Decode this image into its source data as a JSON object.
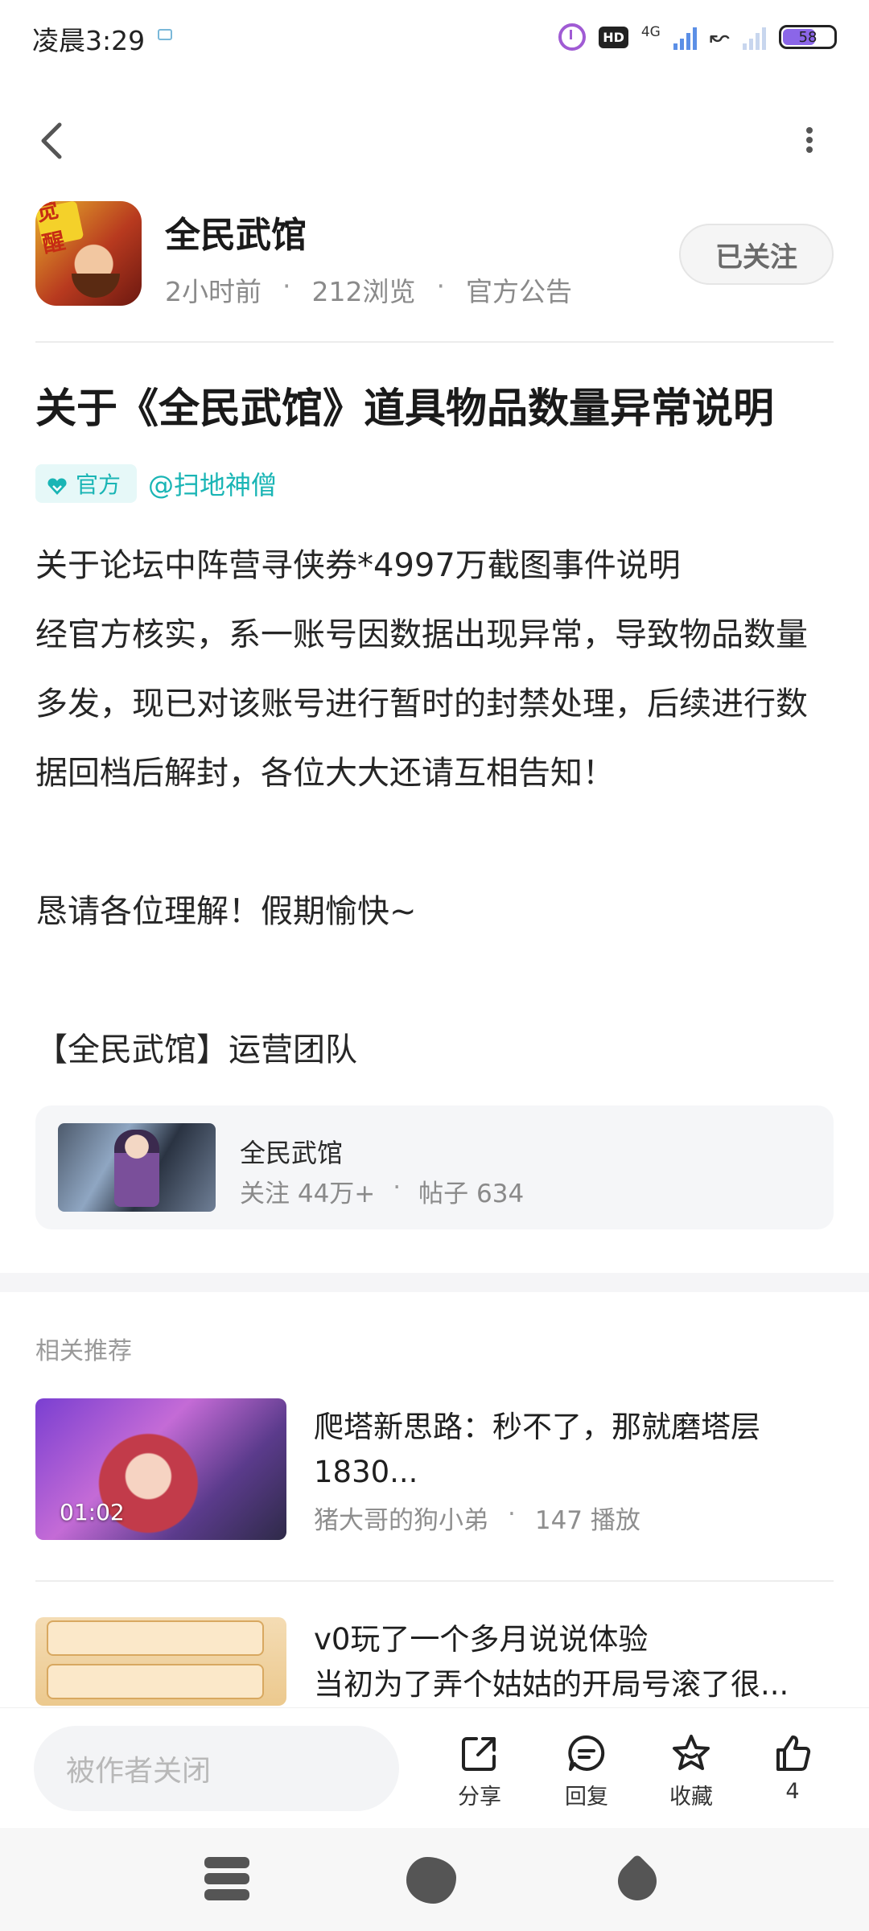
{
  "status_bar": {
    "time": "凌晨3:29",
    "hd": "HD",
    "network": "4G",
    "battery": "58"
  },
  "header": {
    "author": "全民武馆",
    "app_badge": "觉醒",
    "time_ago": "2小时前",
    "views": "212浏览",
    "category": "官方公告",
    "separator": "·",
    "follow_label": "已关注"
  },
  "post": {
    "title": "关于《全民武馆》道具物品数量异常说明",
    "official_tag": "官方",
    "mention": "@扫地神僧",
    "paragraphs": [
      "关于论坛中阵营寻侠券*4997万截图事件说明",
      "经官方核实，系一账号因数据出现异常，导致物品数量多发，现已对该账号进行暂时的封禁处理，后续进行数据回档后解封，各位大大还请互相告知！",
      "",
      "恳请各位理解！假期愉快~",
      "",
      "【全民武馆】运营团队"
    ]
  },
  "forum_card": {
    "name": "全民武馆",
    "followers": "关注 44万+",
    "separator": "·",
    "posts": "帖子 634"
  },
  "related": {
    "label": "相关推荐",
    "items": [
      {
        "title": "爬塔新思路：秒不了，那就磨塔层1830...",
        "duration": "01:02",
        "author": "猪大哥的狗小弟",
        "separator": "·",
        "plays": "147 播放"
      },
      {
        "title": "v0玩了一个多月说说体验\n当初为了弄个姑姑的开局号滚了很..."
      }
    ]
  },
  "action_bar": {
    "comment_placeholder": "被作者关闭",
    "share": "分享",
    "reply": "回复",
    "favorite": "收藏",
    "likes": "4"
  },
  "colors": {
    "accent": "#1ab5b5",
    "tag_bg": "#e6f8f8",
    "text_primary": "#1f1f1f",
    "text_secondary": "#8a8a8a"
  }
}
